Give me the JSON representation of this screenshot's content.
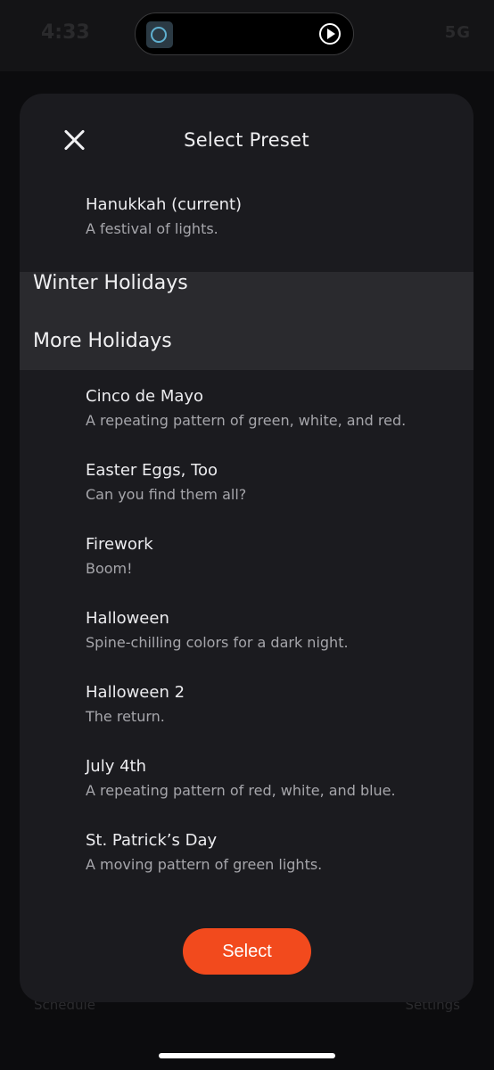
{
  "status_bar": {
    "time": "4:33",
    "network": "5G"
  },
  "background_tabs": {
    "left": "Schedule",
    "right": "Settings"
  },
  "modal": {
    "title": "Select Preset",
    "current": {
      "name": "Hanukkah (current)",
      "desc": "A festival of lights."
    },
    "sections": [
      {
        "label": "Winter Holidays"
      },
      {
        "label": "More Holidays"
      }
    ],
    "presets": [
      {
        "name": "Cinco de Mayo",
        "desc": "A repeating pattern of green, white, and red."
      },
      {
        "name": "Easter Eggs, Too",
        "desc": "Can you find them all?"
      },
      {
        "name": "Firework",
        "desc": "Boom!"
      },
      {
        "name": "Halloween",
        "desc": "Spine-chilling colors for a dark night."
      },
      {
        "name": "Halloween 2",
        "desc": "The return."
      },
      {
        "name": "July 4th",
        "desc": "A repeating pattern of red, white, and blue."
      },
      {
        "name": "St. Patrick’s Day",
        "desc": "A moving pattern of green lights."
      }
    ],
    "select_label": "Select"
  },
  "colors": {
    "accent": "#f24a1d",
    "modal_bg": "#1b1b1f",
    "section_bg": "#2a2a2e"
  },
  "icons": {
    "close": "close-icon",
    "play": "play-circle-icon"
  }
}
